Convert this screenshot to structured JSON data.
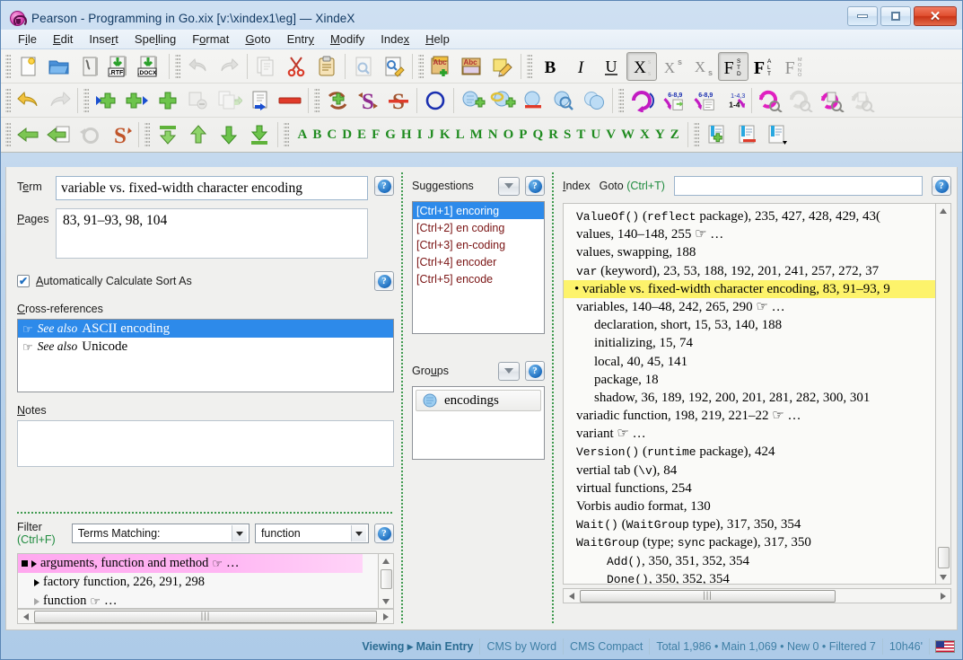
{
  "window": {
    "title": "Pearson - Programming in Go.xix [v:\\xindex1\\eg] — XindeX",
    "app_icon": "xindex-logo-icon",
    "buttons": {
      "minimize": "minimize-button",
      "maximize": "maximize-button",
      "close": "close-button"
    }
  },
  "menubar": {
    "items": [
      {
        "label": "File",
        "pre": "F",
        "acc": "i",
        "post": "le"
      },
      {
        "label": "Edit",
        "pre": "",
        "acc": "E",
        "post": "dit"
      },
      {
        "label": "Insert",
        "pre": "Inse",
        "acc": "r",
        "post": "t"
      },
      {
        "label": "Spelling",
        "pre": "Spe",
        "acc": "l",
        "post": "ling"
      },
      {
        "label": "Format",
        "pre": "F",
        "acc": "o",
        "post": "rmat"
      },
      {
        "label": "Goto",
        "pre": "",
        "acc": "G",
        "post": "oto"
      },
      {
        "label": "Entry",
        "pre": "Entr",
        "acc": "y",
        "post": ""
      },
      {
        "label": "Modify",
        "pre": "",
        "acc": "M",
        "post": "odify"
      },
      {
        "label": "Index",
        "pre": "Inde",
        "acc": "x",
        "post": ""
      },
      {
        "label": "Help",
        "pre": "",
        "acc": "H",
        "post": "elp"
      }
    ]
  },
  "toolbar": {
    "row1": [
      "new-document-icon",
      "open-folder-icon",
      "save-document-icon",
      "export-rtf-icon",
      "export-docx-icon",
      "undo-icon",
      "redo-icon",
      "copy-icon",
      "cut-scissors-icon",
      "paste-clipboard-icon",
      "find-icon",
      "find-replace-icon",
      "spellcheck-add-icon",
      "dictionary-icon",
      "edit-note-icon",
      "bold-icon",
      "italic-icon",
      "underline-icon",
      "clear-format-icon",
      "superscript-icon",
      "subscript-icon",
      "font-standard-icon",
      "font-alt-icon",
      "font-mono-icon"
    ],
    "row2": [
      "undo-gold-icon",
      "redo-gold-icon",
      "add-entry-before-icon",
      "add-entry-after-icon",
      "add-entry-icon",
      "delete-subentry-icon",
      "copy-entry-icon",
      "move-entry-icon",
      "remove-entry-icon",
      "add-crossref-icon",
      "swap-crossref-icon",
      "delete-crossref-icon",
      "group-circle-icon",
      "add-group-icon",
      "link-group-icon",
      "remove-group-icon",
      "find-group-icon",
      "copy-group-icon",
      "swap-pages-icon",
      "merge-page-icon",
      "split-page-icon",
      "renumber-pages-icon",
      "refresh-magenta-icon",
      "refresh-gray-icon",
      "refresh-magenta-alt-icon",
      "refresh-gray-alt-icon"
    ],
    "row3": [
      "back-arrow-icon",
      "forward-arrow-icon",
      "history-circle-icon",
      "redo-orange-icon",
      "first-entry-icon",
      "previous-entry-icon",
      "next-entry-icon",
      "last-entry-icon"
    ],
    "alphabet": [
      "A",
      "B",
      "C",
      "D",
      "E",
      "F",
      "G",
      "H",
      "I",
      "J",
      "K",
      "L",
      "M",
      "N",
      "O",
      "P",
      "Q",
      "R",
      "S",
      "T",
      "U",
      "V",
      "W",
      "X",
      "Y",
      "Z"
    ],
    "row3_right": [
      "add-bookmark-icon",
      "remove-bookmark-icon",
      "bookmark-list-icon"
    ]
  },
  "entry": {
    "term_label_pre": "T",
    "term_label_acc": "e",
    "term_label_post": "rm",
    "term_value": "variable vs. fixed-width character encoding",
    "pages_label_pre": "",
    "pages_label_acc": "P",
    "pages_label_post": "ages",
    "pages_value": "83, 91–93, 98, 104",
    "auto_sort_label_pre": "",
    "auto_sort_label_acc": "A",
    "auto_sort_label_post": "utomatically Calculate Sort As",
    "auto_sort_checked": true,
    "crossref_label_pre": "",
    "crossref_label_acc": "C",
    "crossref_label_post": "ross-references",
    "crossrefs": [
      {
        "kind": "See also",
        "target": "ASCII encoding",
        "selected": true
      },
      {
        "kind": "See also",
        "target": "Unicode",
        "selected": false
      }
    ],
    "notes_label_pre": "",
    "notes_label_acc": "N",
    "notes_label_post": "otes",
    "notes_value": ""
  },
  "filter": {
    "label": "Filter",
    "shortcut": "(Ctrl+F)",
    "mode_value": "Terms Matching:",
    "text_value": "function",
    "results": [
      {
        "marker": "square",
        "caret": "solid",
        "text": "arguments, function and method",
        "hand": true,
        "ellipsis": "…",
        "highlighted": true
      },
      {
        "marker": "none",
        "caret": "solid",
        "text": "factory function, 226, 291, 298",
        "hand": false,
        "ellipsis": "",
        "highlighted": false
      },
      {
        "marker": "none",
        "caret": "hollow",
        "text": "function",
        "hand": true,
        "ellipsis": "…",
        "highlighted": false
      }
    ]
  },
  "suggestions": {
    "title": "Suggestions",
    "dropdown": "suggestions-dropdown-button",
    "help": "suggestions-help-button",
    "items": [
      {
        "key": "[Ctrl+1]",
        "text": "encoring",
        "selected": true
      },
      {
        "key": "[Ctrl+2]",
        "text": "en coding",
        "selected": false
      },
      {
        "key": "[Ctrl+3]",
        "text": "en-coding",
        "selected": false
      },
      {
        "key": "[Ctrl+4]",
        "text": "encoder",
        "selected": false
      },
      {
        "key": "[Ctrl+5]",
        "text": "encode",
        "selected": false
      }
    ]
  },
  "groups": {
    "title_pre": "Gro",
    "title_acc": "u",
    "title_post": "ps",
    "items": [
      {
        "label": "encodings",
        "icon": "group-cluster-icon"
      }
    ]
  },
  "index": {
    "label_pre": "",
    "label_acc": "I",
    "label_post": "ndex",
    "goto_label": "Goto",
    "goto_shortcut": "(Ctrl+T)",
    "goto_value": "",
    "entries": [
      {
        "indent": 0,
        "mono": "ValueOf()",
        "text": " (",
        "mono2": "reflect",
        "text2": " package), 235, 427, 428, 429, 43("
      },
      {
        "indent": 0,
        "text": "values, 140–148, 255 ☞ …"
      },
      {
        "indent": 0,
        "text": "values, swapping, 188"
      },
      {
        "indent": 0,
        "mono": "var",
        "text": " (keyword), 23, 53, 188, 192, 201, 241, 257, 272, 37"
      },
      {
        "indent": 0,
        "text": "• variable vs. fixed-width character encoding, 83, 91–93, 9",
        "highlighted": true
      },
      {
        "indent": 0,
        "text": "variables, 140–48, 242, 265, 290 ☞ …"
      },
      {
        "indent": 1,
        "text": "declaration, short, 15, 53, 140, 188"
      },
      {
        "indent": 1,
        "text": "initializing, 15, 74"
      },
      {
        "indent": 1,
        "text": "local, 40, 45, 141"
      },
      {
        "indent": 1,
        "text": "package, 18"
      },
      {
        "indent": 1,
        "text": "shadow, 36, 189, 192, 200, 201, 281, 282, 300, 301"
      },
      {
        "indent": 0,
        "text": "variadic function, 198, 219, 221–22 ☞ …"
      },
      {
        "indent": 0,
        "text": "variant ☞ …"
      },
      {
        "indent": 0,
        "mono": "Version()",
        "text": " (",
        "mono2": "runtime",
        "text2": " package), 424"
      },
      {
        "indent": 0,
        "text": "vertial tab (",
        "mono2": "\\v",
        "text2": "), 84"
      },
      {
        "indent": 0,
        "text": "virtual functions, 254"
      },
      {
        "indent": 0,
        "text": "Vorbis audio format, 130"
      },
      {
        "indent": 0,
        "mono": "Wait()",
        "text": " (",
        "mono2": "WaitGroup",
        "text2": " type), 317, 350, 354"
      },
      {
        "indent": 0,
        "mono": "WaitGroup",
        "text": " (type; ",
        "mono2": "sync",
        "text2": " package), 317, 350"
      },
      {
        "indent": 1,
        "mono": "Add()",
        "text": ", 350, 351, 352, 354"
      },
      {
        "indent": 1,
        "mono": "Done()",
        "text": ", 350, 352, 354"
      }
    ]
  },
  "statusbar": {
    "cells": [
      "Viewing ▸ Main Entry",
      "CMS by Word",
      "CMS Compact",
      "Total 1,986 • Main 1,069 • New 0 • Filtered 7",
      "10h46'"
    ],
    "flag": "us-flag-icon"
  },
  "colors": {
    "accent_blue": "#2d8aea",
    "highlight_yellow": "#fdf36b",
    "filter_highlight_pink": "#ffa8ef",
    "alphabet_green": "#1f8b1f",
    "status_text": "#3f7fa5",
    "suggestion_text": "#7a1414"
  }
}
